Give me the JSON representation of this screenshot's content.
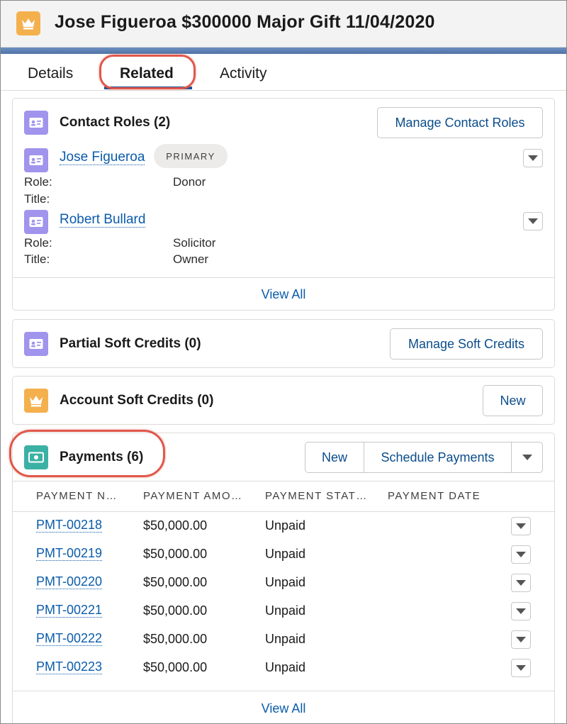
{
  "record": {
    "title": "Jose Figueroa $300000 Major Gift 11/04/2020",
    "icon": "crown-icon"
  },
  "tabs": [
    {
      "label": "Details",
      "active": false
    },
    {
      "label": "Related",
      "active": true
    },
    {
      "label": "Activity",
      "active": false
    }
  ],
  "contact_roles": {
    "title": "Contact Roles (2)",
    "manage_label": "Manage Contact Roles",
    "contacts": [
      {
        "name": "Jose Figueroa",
        "badge": "PRIMARY",
        "role_label": "Role:",
        "role": "Donor",
        "title_label": "Title:",
        "title": ""
      },
      {
        "name": "Robert Bullard",
        "badge": "",
        "role_label": "Role:",
        "role": "Solicitor",
        "title_label": "Title:",
        "title": "Owner"
      }
    ],
    "view_all": "View All"
  },
  "partial_soft_credits": {
    "title": "Partial Soft Credits (0)",
    "manage_label": "Manage Soft Credits"
  },
  "account_soft_credits": {
    "title": "Account Soft Credits (0)",
    "new_label": "New"
  },
  "payments": {
    "title": "Payments (6)",
    "new_label": "New",
    "schedule_label": "Schedule Payments",
    "columns": [
      "PAYMENT N…",
      "PAYMENT AMO…",
      "PAYMENT STAT…",
      "PAYMENT DATE"
    ],
    "rows": [
      {
        "name": "PMT-00218",
        "amount": "$50,000.00",
        "status": "Unpaid",
        "date": ""
      },
      {
        "name": "PMT-00219",
        "amount": "$50,000.00",
        "status": "Unpaid",
        "date": ""
      },
      {
        "name": "PMT-00220",
        "amount": "$50,000.00",
        "status": "Unpaid",
        "date": ""
      },
      {
        "name": "PMT-00221",
        "amount": "$50,000.00",
        "status": "Unpaid",
        "date": ""
      },
      {
        "name": "PMT-00222",
        "amount": "$50,000.00",
        "status": "Unpaid",
        "date": ""
      },
      {
        "name": "PMT-00223",
        "amount": "$50,000.00",
        "status": "Unpaid",
        "date": ""
      }
    ],
    "view_all": "View All"
  },
  "colors": {
    "link": "#0b5cab",
    "callout": "#e0574a",
    "contact_icon": "#a094ed",
    "crown_icon": "#f4b04d",
    "payment_icon": "#3bb1a5"
  }
}
